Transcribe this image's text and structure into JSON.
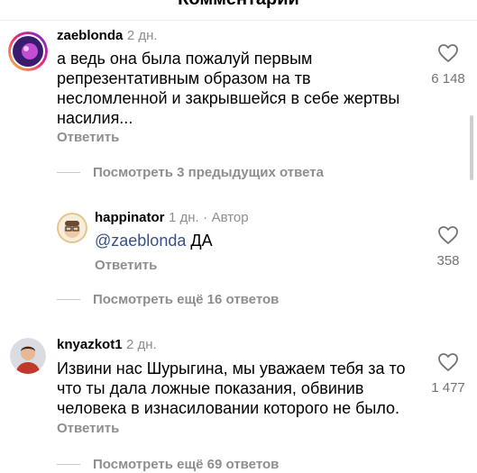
{
  "header": {
    "title": "Комментарии"
  },
  "comments": [
    {
      "username": "zaeblonda",
      "time": "2 дн.",
      "lines": [
        "а ведь она была пожалуй первым",
        "репрезентативным образом на тв",
        "несломленной и закрывшейся в себе жертвы",
        "насилия..."
      ],
      "reply_label": "Ответить",
      "likes": "6 148",
      "thread_label": "Посмотреть 3 предыдущих ответа"
    },
    {
      "username": "happinator",
      "time": "1 дн.",
      "separator": "·",
      "author_badge": "Автор",
      "mention": "@zaeblonda",
      "text_after": "ДА",
      "reply_label": "Ответить",
      "likes": "358",
      "thread_label": "Посмотреть ещё 16 ответов"
    },
    {
      "username": "knyazkot1",
      "time": "2 дн.",
      "lines": [
        "Извини нас Шурыгина, мы уважаем тебя за то",
        "что ты дала ложные показания, обвинив",
        "человека в изнасиловании которого не было."
      ],
      "reply_label": "Ответить",
      "likes": "1 477",
      "thread_label": "Посмотреть ещё 69 ответов"
    }
  ],
  "icons": {
    "like": "heart-outline-icon"
  },
  "colors": {
    "secondary_text": "#8e8e8e",
    "mention": "#385185"
  }
}
